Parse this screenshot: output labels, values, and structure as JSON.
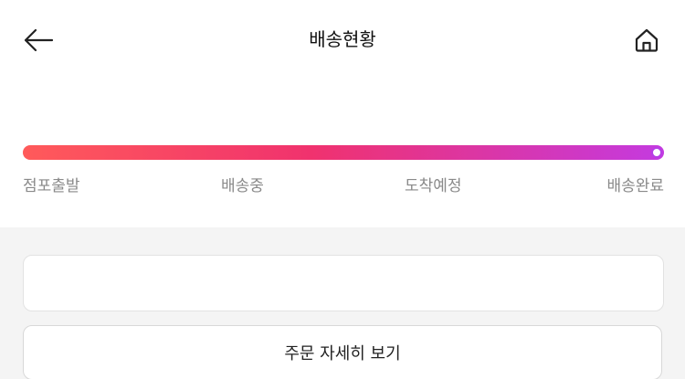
{
  "header": {
    "title": "배송현황",
    "back_icon": "arrow-left-icon",
    "home_icon": "home-icon"
  },
  "progress": {
    "value": 1.0,
    "colors": {
      "start": "#ff5a5a",
      "middle": "#f0326e",
      "end": "#c43ae0"
    },
    "steps": [
      {
        "label": "점포출발"
      },
      {
        "label": "배송중"
      },
      {
        "label": "도착예정"
      },
      {
        "label": "배송완료"
      }
    ]
  },
  "actions": {
    "detail_label": "주문 자세히 보기"
  }
}
